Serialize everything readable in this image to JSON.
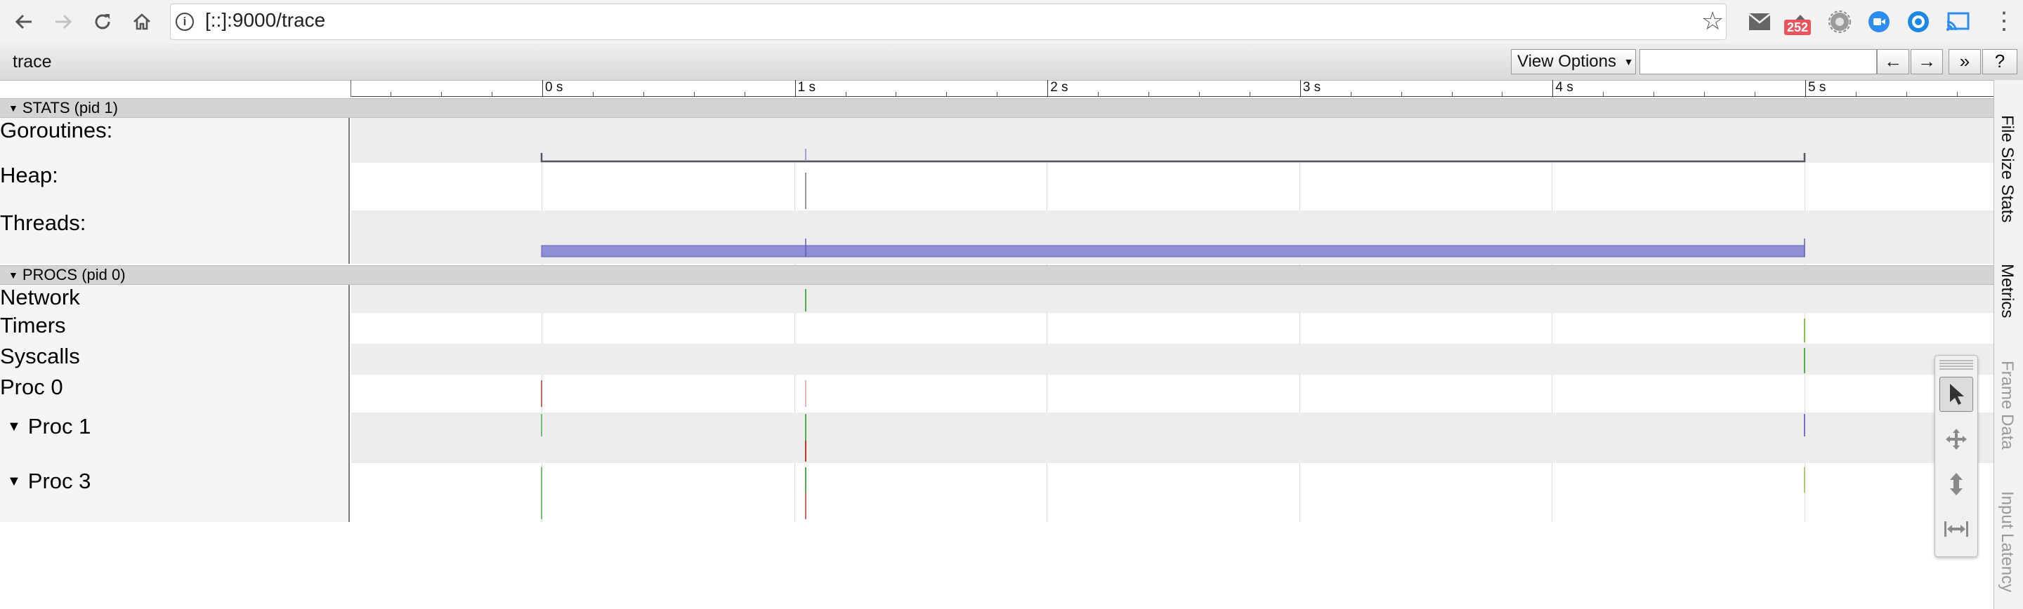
{
  "browser": {
    "url": "[::]:9000/trace",
    "badge_count": "252"
  },
  "toolbar": {
    "title": "trace",
    "view_options_label": "View Options",
    "search_placeholder": "",
    "prev_label": "←",
    "next_label": "→",
    "more_label": "»",
    "help_label": "?"
  },
  "ruler": {
    "ticks": [
      "0 s",
      "1 s",
      "2 s",
      "3 s",
      "4 s",
      "5 s"
    ]
  },
  "processes": [
    {
      "title": "STATS (pid 1)",
      "tracks": [
        {
          "label": "Goroutines:"
        },
        {
          "label": "Heap:"
        },
        {
          "label": "Threads:"
        }
      ]
    },
    {
      "title": "PROCS (pid 0)",
      "tracks": [
        {
          "label": "Network"
        },
        {
          "label": "Timers"
        },
        {
          "label": "Syscalls"
        },
        {
          "label": "Proc 0"
        },
        {
          "label": "Proc 1"
        },
        {
          "label": "Proc 3"
        }
      ]
    }
  ],
  "side_tabs": [
    {
      "label": "File Size Stats",
      "state": "active"
    },
    {
      "label": "Metrics",
      "state": "active"
    },
    {
      "label": "Frame Data",
      "state": "inactive"
    },
    {
      "label": "Input Latency",
      "state": "inactive"
    }
  ],
  "mouse_modes": [
    {
      "icon": "arrow-pointer-icon",
      "state": "active"
    },
    {
      "icon": "pan-arrows-icon",
      "state": "inactive"
    },
    {
      "icon": "zoom-vertical-icon",
      "state": "inactive"
    },
    {
      "icon": "timing-horizontal-icon",
      "state": "inactive"
    }
  ],
  "colors": {
    "threads_fill": "#8f8fd8",
    "goroutines_line": "#555566",
    "event_green": "#4caf50",
    "event_red": "#c0392b",
    "event_purple": "#7a6fc8"
  }
}
